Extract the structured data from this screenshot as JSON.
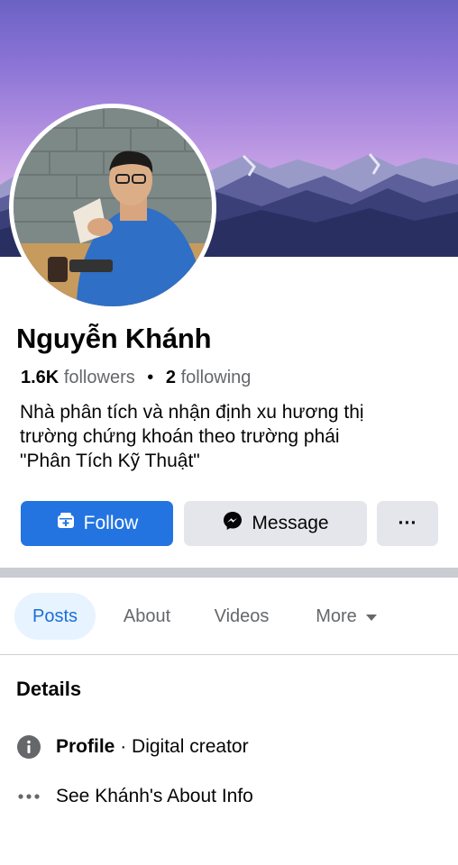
{
  "profile": {
    "name": "Nguyễn Khánh",
    "followers_count": "1.6K",
    "followers_label": "followers",
    "following_count": "2",
    "following_label": "following",
    "separator": "•",
    "bio_line1": "Nhà phân tích và nhận định xu hương thị",
    "bio_line2": "trường chứng khoán theo trường phái",
    "bio_line3": "\"Phân Tích Kỹ Thuật\""
  },
  "actions": {
    "follow_label": "Follow",
    "message_label": "Message",
    "more_label": "···"
  },
  "tabs": [
    {
      "label": "Posts",
      "active": true
    },
    {
      "label": "About",
      "active": false
    },
    {
      "label": "Videos",
      "active": false
    },
    {
      "label": "More",
      "active": false
    }
  ],
  "details": {
    "title": "Details",
    "profile_label": "Profile",
    "profile_sep": " · ",
    "profile_value": "Digital creator",
    "see_about_label": "See Khánh's About Info"
  },
  "icons": {
    "follow": "follow-icon",
    "message": "messenger-icon",
    "more": "more-dots-icon",
    "tab_more": "caret-down-icon",
    "info": "info-icon",
    "dots": "ellipsis-icon"
  },
  "colors": {
    "primary": "#2374e1",
    "tab_active_bg": "#e7f3ff",
    "tab_active_text": "#1b6fd8",
    "secondary_button": "#e4e6eb",
    "muted_text": "#65676b"
  }
}
